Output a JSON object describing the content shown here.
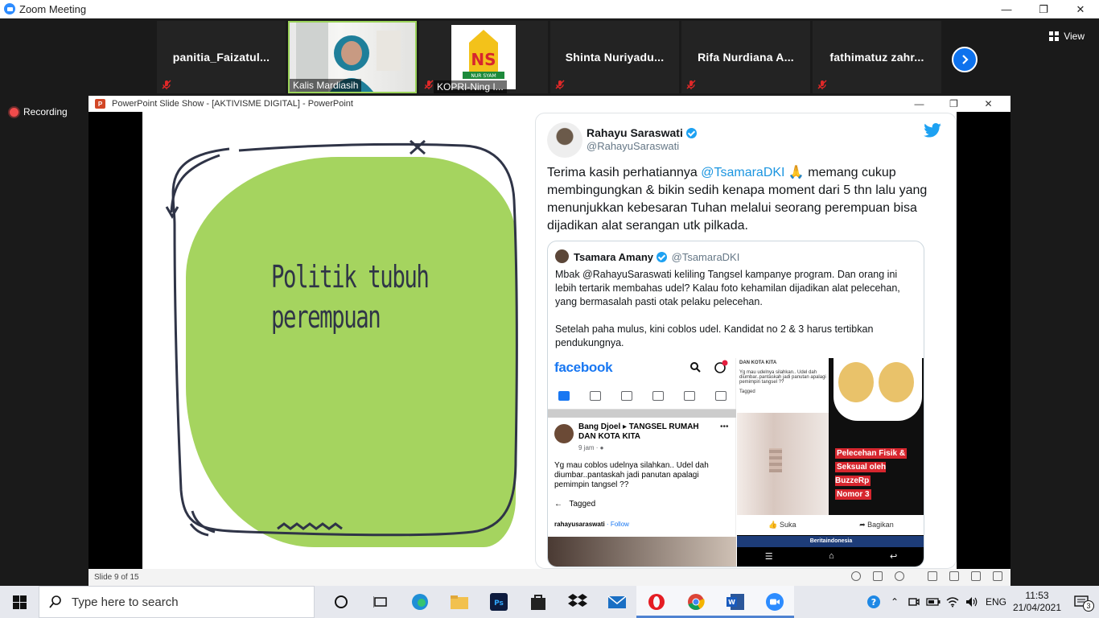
{
  "window": {
    "title": "Zoom Meeting",
    "minimize": "—",
    "maximize": "❐",
    "close": "✕"
  },
  "participants": [
    {
      "name": "panitia_Faizatul...",
      "type": "name"
    },
    {
      "name": "Kalis Mardiasih",
      "type": "video"
    },
    {
      "name": "KOPRI-Ning I...",
      "type": "logo"
    },
    {
      "name": "Shinta Nuriyadu...",
      "type": "name"
    },
    {
      "name": "Rifa Nurdiana A...",
      "type": "name"
    },
    {
      "name": "fathimatuz zahr...",
      "type": "name"
    }
  ],
  "logo_text": {
    "main": "NS",
    "sub": "NUR SYAM"
  },
  "view_label": "View",
  "recording_label": "Recording",
  "ppt": {
    "title": "PowerPoint Slide Show - [AKTIVISME DIGITAL] - PowerPoint",
    "slide_title_line1": "Politik tubuh",
    "slide_title_line2": "perempuan",
    "status": "Slide 9 of 15"
  },
  "tweet": {
    "name": "Rahayu Saraswati",
    "handle": "@RahayuSaraswati",
    "text_before": "Terima kasih perhatiannya ",
    "mention": "@TsamaraDKI",
    "text_after": " 🙏 memang cukup membingungkan & bikin sedih kenapa moment dari 5 thn lalu yang menunjukkan kebesaran Tuhan melalui seorang perempuan bisa dijadikan alat serangan utk pilkada.",
    "quote": {
      "name": "Tsamara Amany",
      "handle": "@TsamaraDKI",
      "para1": "Mbak @RahayuSaraswati keliling Tangsel kampanye program. Dan orang ini lebih tertarik membahas udel? Kalau foto kehamilan dijadikan alat pelecehan, yang bermasalah pasti otak pelaku pelecehan.",
      "para2": "Setelah paha mulus, kini coblos udel. Kandidat no 2 & 3 harus tertibkan pendukungnya."
    },
    "fb": {
      "logo": "facebook",
      "poster": "Bang Djoel ▸ TANGSEL RUMAH DAN KOTA KITA",
      "time": "9 jam · ●",
      "body": "Yg mau coblos udelnya silahkan.. Udel dah diumbar..pantaskah jadi panutan apalagi pemimpin tangsel ??",
      "tagged": "Tagged",
      "reply_user": "rahayusaraswati",
      "reply_action": " · Follow"
    },
    "clip": {
      "header": "DAN KOTA KITA",
      "snippet": "Yg mau udelnya silahkan.. Udel dah diumbar..pantaskah jadi panutan apalagi pemimpin tangsel ??",
      "tagged": "Tagged"
    },
    "image_label": [
      "Pelecehan Fisik &",
      "Seksual oleh BuzzeRp",
      "Nomor 3"
    ],
    "like_label": "Suka",
    "share_label": "Bagikan",
    "news_bar": "Beritaindonesia"
  },
  "taskbar": {
    "search_placeholder": "Type here to search",
    "lang": "ENG",
    "time": "11:53",
    "date": "21/04/2021",
    "notif_count": "3"
  },
  "colors": {
    "zoom_blue": "#2D8CFF",
    "slide_green": "#a5d45f",
    "twitter_blue": "#1da1f2",
    "recording_red": "#f04b4b"
  }
}
